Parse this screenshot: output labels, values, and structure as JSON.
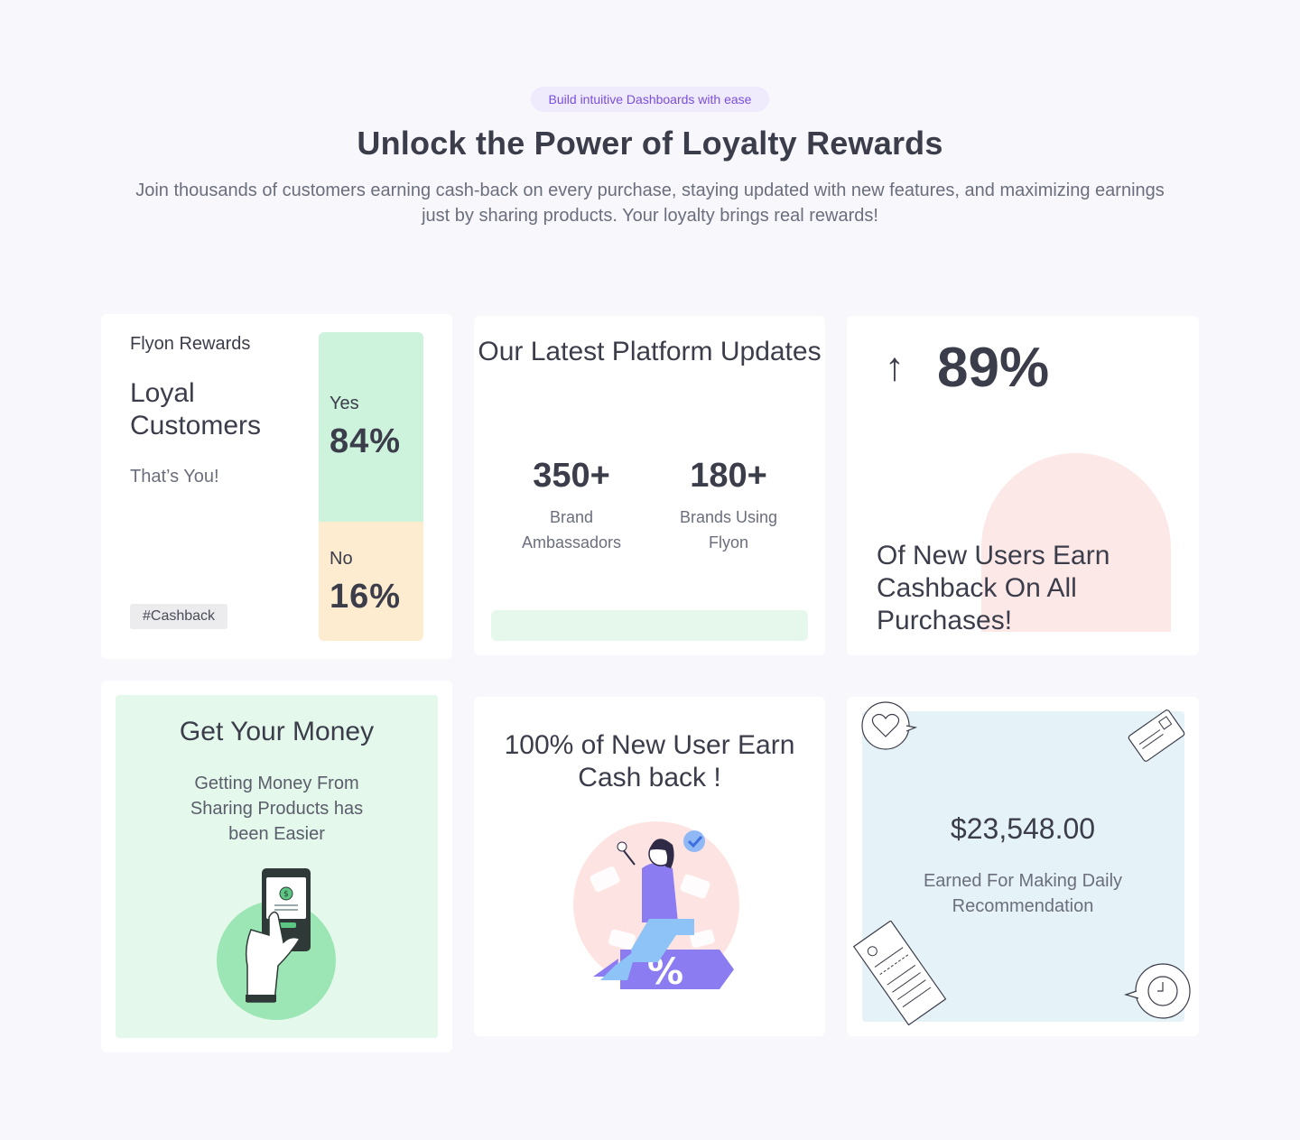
{
  "header": {
    "badge": "Build intuitive Dashboards with ease",
    "title": "Unlock the Power of Loyalty Rewards",
    "subtitle": "Join thousands of customers earning cash-back on every purchase, staying updated with new features, and maximizing earnings just by sharing products. Your loyalty brings real rewards!"
  },
  "loyal_card": {
    "brand": "Flyon Rewards",
    "heading": "Loyal Customers",
    "subtext": "That’s You!",
    "tag": "#Cashback",
    "yes_label": "Yes",
    "yes_value": "84%",
    "yes_fraction": 0.84,
    "no_label": "No",
    "no_value": "16%",
    "yes_color": "#cdf3dc",
    "no_color": "#fdecd0"
  },
  "updates_card": {
    "title": "Our Latest Platform Updates",
    "stats": [
      {
        "value": "350+",
        "label": "Brand Ambassadors"
      },
      {
        "value": "180+",
        "label": "Brands Using Flyon"
      }
    ]
  },
  "growth_card": {
    "arrow": "↑",
    "value": "89%",
    "text": "Of New Users Earn Cashback On All Purchases!",
    "blob_color": "#fde8e8"
  },
  "money_card": {
    "title": "Get Your Money",
    "subtitle": "Getting Money From Sharing Products has been Easier",
    "illustration": "phone-payment-icon"
  },
  "new_user_card": {
    "title": "100% of New User Earn Cash back !",
    "illustration": "discount-woman-icon"
  },
  "earned_card": {
    "amount": "$23,548.00",
    "subtitle": "Earned For Making Daily Recommendation",
    "doodles": [
      "heart-bubble-icon",
      "credit-card-icon",
      "receipt-icon",
      "clock-bubble-icon"
    ]
  },
  "colors": {
    "background": "#f7f7fc",
    "accent": "#7a4fe0",
    "green_panel": "#e4f8ec",
    "blue_panel": "#e5f2f8"
  }
}
